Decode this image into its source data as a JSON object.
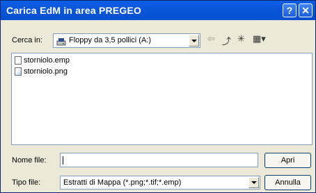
{
  "dialog": {
    "title": "Carica EdM in area PREGEO",
    "help_label": "?",
    "close_label": "✕"
  },
  "look_in": {
    "label": "Cerca in:",
    "value": "Floppy da 3,5 pollici (A:)"
  },
  "toolbar": {
    "back_icon": "⇦",
    "up_icon": "⤴",
    "new_folder_icon": "✳",
    "view_menu_icon": "▦▾"
  },
  "files": [
    {
      "name": "storniolo.emp",
      "icon": "file-icon"
    },
    {
      "name": "storniolo.png",
      "icon": "image-file-icon"
    }
  ],
  "filename": {
    "label": "Nome file:",
    "value": ""
  },
  "filetype": {
    "label": "Tipo file:",
    "value": "Estratti di Mappa (*.png;*.tif;*.emp)"
  },
  "buttons": {
    "open_label": "Apri",
    "cancel_label": "Annulla"
  }
}
